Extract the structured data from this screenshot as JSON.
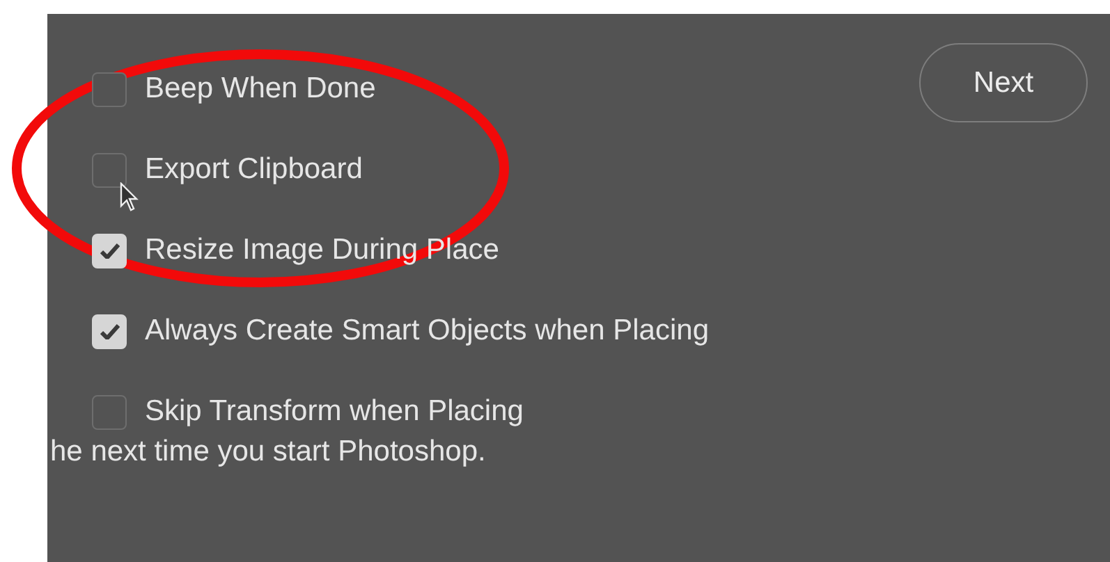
{
  "options": [
    {
      "label": "Beep When Done",
      "checked": false
    },
    {
      "label": "Export Clipboard",
      "checked": false
    },
    {
      "label": "Resize Image During Place",
      "checked": true
    },
    {
      "label": "Always Create Smart Objects when Placing",
      "checked": true
    },
    {
      "label": "Skip Transform when Placing",
      "checked": false
    }
  ],
  "note": "he next time you start Photoshop.",
  "buttons": [
    "Next"
  ]
}
